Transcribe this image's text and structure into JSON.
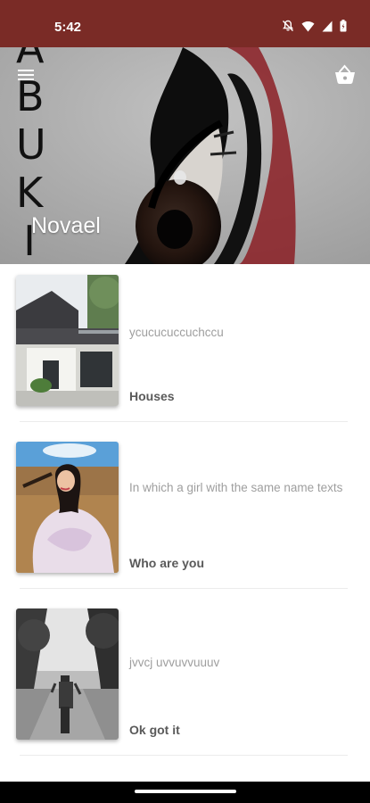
{
  "status_bar": {
    "time": "5:42",
    "icons": [
      "notifications-muted-icon",
      "wifi-icon",
      "signal-icon",
      "battery-icon"
    ],
    "background": "#7a2b26"
  },
  "hero": {
    "title": "Novael",
    "art_letters": [
      "A",
      "B",
      "U",
      "K",
      "I"
    ],
    "menu_icon": "menu-icon",
    "cart_icon": "basket-icon"
  },
  "stories": [
    {
      "description": "ycucucuccuchccu",
      "title": "Houses",
      "image": "house-photo"
    },
    {
      "description": "In which a girl with the same name texts",
      "title": "Who are you",
      "image": "girl-in-field-photo"
    },
    {
      "description": "jvvcj uvvuvvuuuv",
      "title": "Ok got it",
      "image": "woman-on-path-photo"
    }
  ],
  "colors": {
    "accent": "#7a2b26",
    "description_text": "#9e9e9e",
    "title_text": "#5a5a5a"
  }
}
